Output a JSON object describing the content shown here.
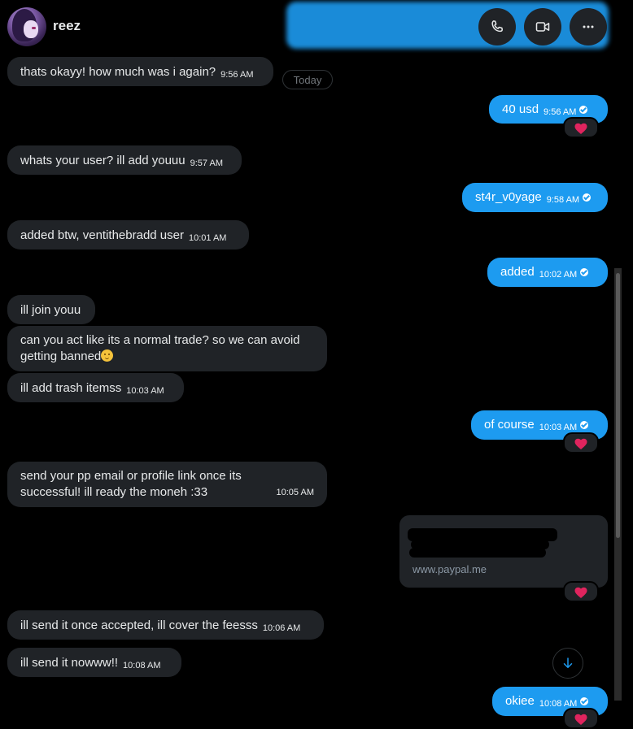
{
  "header": {
    "username": "reez"
  },
  "divider": {
    "today": "Today"
  },
  "messages": {
    "m1": {
      "text": "thats okayy! how much was i again?",
      "time": "9:56 AM"
    },
    "m2": {
      "text": "40 usd",
      "time": "9:56 AM"
    },
    "m3": {
      "text": "whats your user? ill add youuu",
      "time": "9:57 AM"
    },
    "m4": {
      "text": "st4r_v0yage",
      "time": "9:58 AM"
    },
    "m5": {
      "text": "added btw, ventithebradd user",
      "time": "10:01 AM"
    },
    "m6": {
      "text": "added",
      "time": "10:02 AM"
    },
    "m7": {
      "text": "ill join youu"
    },
    "m8": {
      "text": "can you act like its a normal trade? so we can avoid getting banned"
    },
    "m9": {
      "text": "ill add trash itemss",
      "time": "10:03 AM"
    },
    "m10": {
      "text": "of course",
      "time": "10:03 AM"
    },
    "m11": {
      "text": "send your pp email or profile link once its successful! ill ready the moneh :33",
      "time": "10:05 AM"
    },
    "m12": {
      "domain": "www.paypal.me"
    },
    "m13": {
      "text": "ill send it once accepted, ill cover the feesss",
      "time": "10:06 AM"
    },
    "m14": {
      "text": "ill send it nowww!!",
      "time": "10:08 AM"
    },
    "m15": {
      "text": "okiee",
      "time": "10:08 AM"
    }
  },
  "colors": {
    "background": "#000000",
    "outgoing_bubble": "#1d9bf0",
    "incoming_bubble": "#202327",
    "reaction_heart": "#f91880"
  },
  "icons": [
    "phone-icon",
    "video-icon",
    "more-icon",
    "heart-reaction-icon",
    "arrow-down-icon",
    "read-check-icon"
  ]
}
